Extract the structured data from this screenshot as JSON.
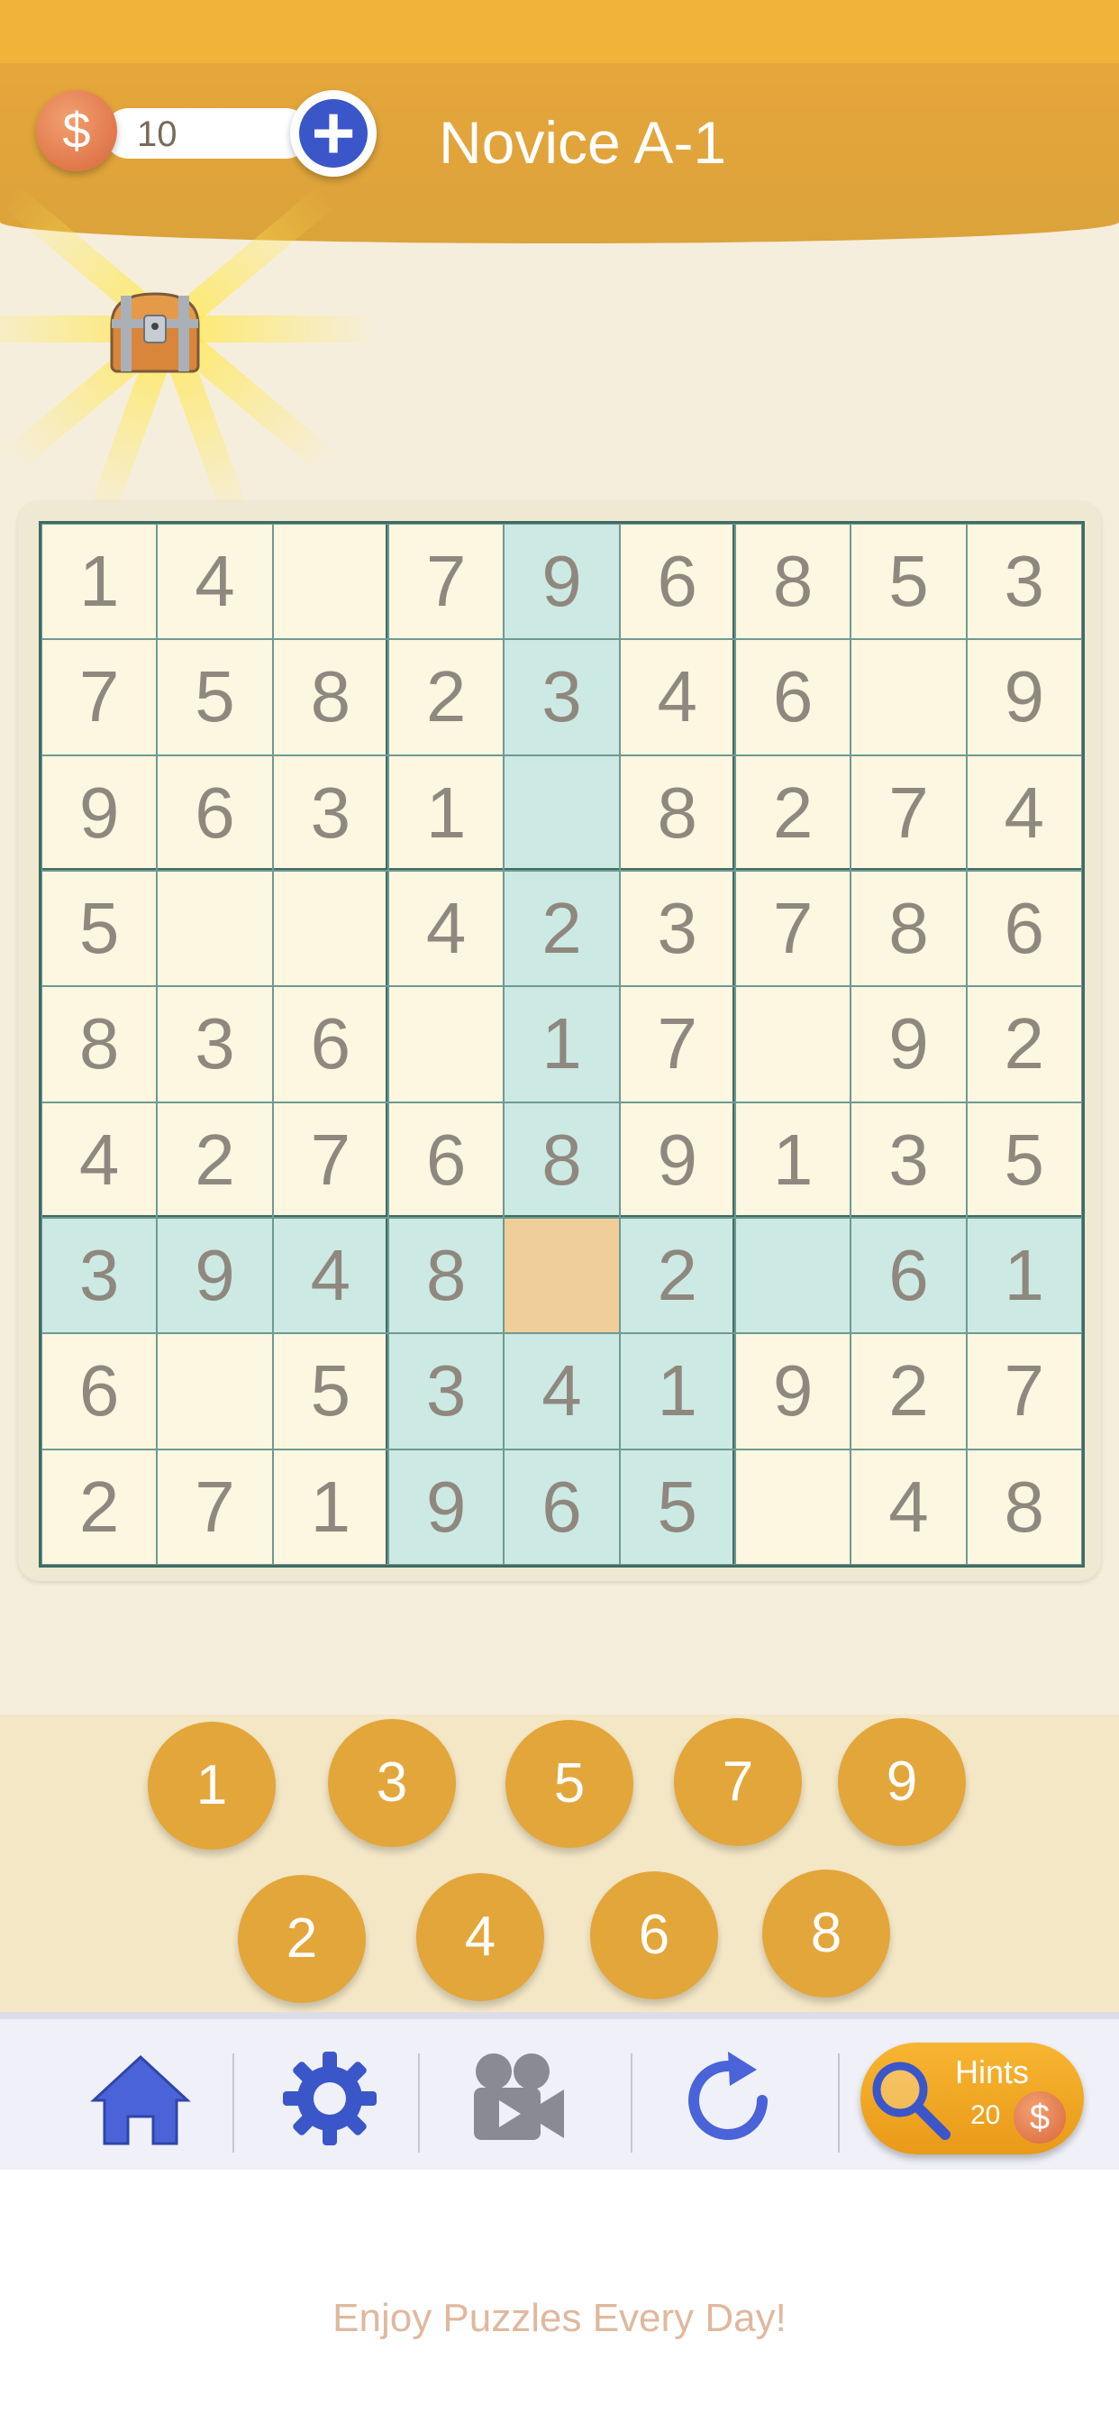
{
  "header": {
    "coins": "10",
    "coin_symbol": "$",
    "add_symbol": "+",
    "level_title": "Novice A-1"
  },
  "board": {
    "rows": [
      [
        "1",
        "4",
        "",
        "7",
        "9",
        "6",
        "8",
        "5",
        "3"
      ],
      [
        "7",
        "5",
        "8",
        "2",
        "3",
        "4",
        "6",
        "",
        "9"
      ],
      [
        "9",
        "6",
        "3",
        "1",
        "",
        "8",
        "2",
        "7",
        "4"
      ],
      [
        "5",
        "",
        "",
        "4",
        "2",
        "3",
        "7",
        "8",
        "6"
      ],
      [
        "8",
        "3",
        "6",
        "",
        "1",
        "7",
        "",
        "9",
        "2"
      ],
      [
        "4",
        "2",
        "7",
        "6",
        "8",
        "9",
        "1",
        "3",
        "5"
      ],
      [
        "3",
        "9",
        "4",
        "8",
        "",
        "2",
        "",
        "6",
        "1"
      ],
      [
        "6",
        "",
        "5",
        "3",
        "4",
        "1",
        "9",
        "2",
        "7"
      ],
      [
        "2",
        "7",
        "1",
        "9",
        "6",
        "5",
        "",
        "4",
        "8"
      ]
    ],
    "selected_cell": {
      "row": 7,
      "col": 5
    },
    "colors": {
      "highlight": "#cde9e3",
      "selected": "#f0ce9a",
      "cell": "#fdf6e0",
      "grid": "#3f6b63"
    }
  },
  "number_pad": {
    "top_row": [
      "1",
      "3",
      "5",
      "7",
      "9"
    ],
    "bottom_row": [
      "2",
      "4",
      "6",
      "8"
    ]
  },
  "toolbar": {
    "icons": [
      "home-icon",
      "gear-icon",
      "video-camera-icon",
      "refresh-icon",
      "magnifier-icon"
    ],
    "hints_label": "Hints",
    "hints_cost": "20",
    "coin_symbol": "$"
  },
  "footer": {
    "tagline": "Enjoy Puzzles Every Day!"
  },
  "colors": {
    "accent": "#e3a63b",
    "header": "#dba33b",
    "icon_blue": "#3b56c9",
    "text_gray": "#8f887f"
  }
}
